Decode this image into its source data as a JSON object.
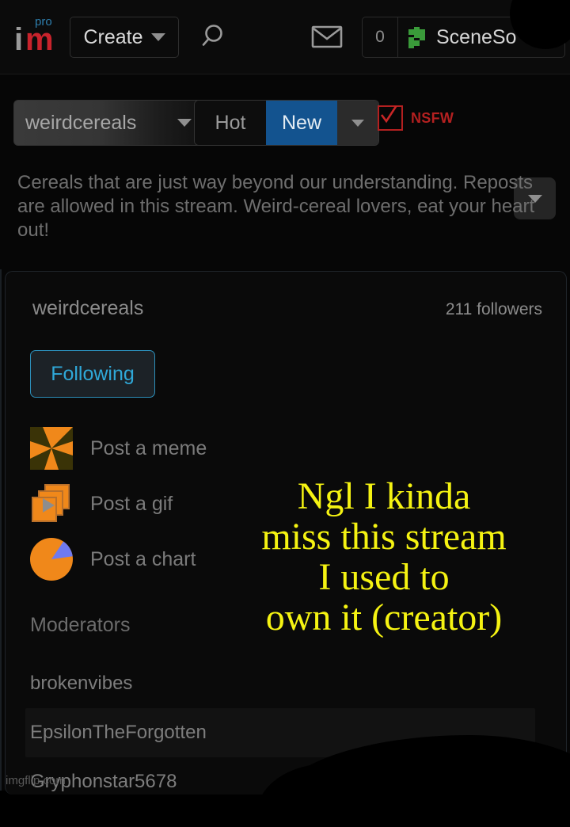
{
  "header": {
    "logo": {
      "text_i": "i",
      "text_m": "m",
      "badge": "pro",
      "icon": "imgflip-logo"
    },
    "create_label": "Create",
    "search_icon": "search-icon",
    "mail_icon": "envelope-icon",
    "notification_count": "0",
    "username": "SceneSo",
    "avatar_icon": "user-identicon",
    "colors": {
      "logo_red": "#c8232c",
      "logo_pro_blue": "#2e7fae",
      "avatar_green": "#3a9b3a"
    }
  },
  "filterbar": {
    "stream_select_value": "weirdcereals",
    "sort_options": [
      "Hot",
      "New"
    ],
    "sort_selected": "New",
    "nsfw_label": "NSFW",
    "nsfw_checked": true,
    "colors": {
      "selected_blue": "#13538f",
      "nsfw_red": "#b32020"
    }
  },
  "description": "Cereals that are just way beyond our understanding. Reposts are allowed in this stream. Weird-cereal lovers, eat your heart out!",
  "card": {
    "stream_name": "weirdcereals",
    "followers": "211 followers",
    "follow_button_label": "Following",
    "follow_button_color": "#2fa8d8",
    "actions": [
      {
        "label": "Post a meme",
        "icon": "meme-pinwheel-icon"
      },
      {
        "label": "Post a gif",
        "icon": "gif-stack-icon"
      },
      {
        "label": "Post a chart",
        "icon": "pie-chart-icon"
      }
    ],
    "moderators_heading": "Moderators",
    "moderators": [
      {
        "name": "brokenvibes",
        "highlighted": false
      },
      {
        "name": "EpsilonTheForgotten",
        "highlighted": true
      },
      {
        "name": "Gryphonstar5678",
        "highlighted": false
      }
    ]
  },
  "overlay": {
    "meme_text": "Ngl I kinda\nmiss this stream\nI used to\nown it (creator)",
    "meme_text_color": "#f5f312"
  },
  "watermark": "imgflip.com"
}
